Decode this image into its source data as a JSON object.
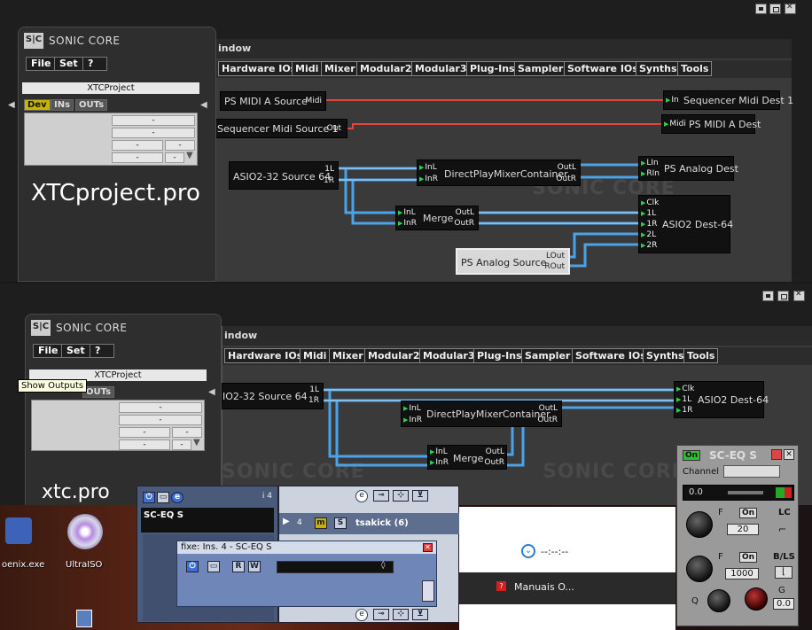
{
  "top": {
    "window_title": "indow",
    "tabs": [
      "Hardware IOs",
      "Midi",
      "Mixer",
      "Modular2",
      "Modular3",
      "Plug-Ins",
      "Sampler",
      "Software IOs",
      "Synths",
      "Tools"
    ],
    "sidebar": {
      "brand": "SONIC CORE",
      "logo": "S|C",
      "menu": [
        "File",
        "Set",
        "?"
      ],
      "project": "XTCProject",
      "subtabs": [
        "Dev",
        "INs",
        "OUTs"
      ],
      "cells": [
        "-",
        "-",
        "-",
        "-",
        "-",
        "-"
      ],
      "big_label": "XTCproject.pro"
    },
    "watermark": "SONIC CORE",
    "nodes": {
      "ps_midi_src": {
        "name": "PS MIDI A Source",
        "pin": "Midi"
      },
      "seq_midi_dest": {
        "pin": "In",
        "name": "Sequencer Midi Dest 1"
      },
      "seq_midi_src": {
        "name": "Sequencer Midi Source 1",
        "pin": "Out"
      },
      "ps_midi_dest": {
        "pin": "Midi",
        "name": "PS MIDI A Dest"
      },
      "asio_src": {
        "name": "ASIO2-32 Source 64",
        "pins": [
          "1L",
          "1R"
        ]
      },
      "dpmc": {
        "name": "DirectPlayMixerContainer",
        "in": [
          "InL",
          "InR"
        ],
        "out": [
          "OutL",
          "OutR"
        ]
      },
      "ps_analog_dest": {
        "name": "PS Analog Dest",
        "pins": [
          "LIn",
          "RIn"
        ]
      },
      "merge": {
        "name": "Merge",
        "in": [
          "InL",
          "InR"
        ],
        "out": [
          "OutL",
          "OutR"
        ]
      },
      "asio_dest": {
        "name": "ASIO2 Dest-64",
        "pins": [
          "Clk",
          "1L",
          "1R",
          "2L",
          "2R"
        ]
      },
      "ps_analog_src": {
        "name": "PS Analog Source",
        "pins": [
          "LOut",
          "ROut"
        ]
      }
    }
  },
  "bottom": {
    "window_title": "indow",
    "tabs": [
      "Hardware IOs",
      "Midi",
      "Mixer",
      "Modular2",
      "Modular3",
      "Plug-Ins",
      "Sampler",
      "Software IOs",
      "Synths",
      "Tools"
    ],
    "sidebar": {
      "brand": "SONIC CORE",
      "logo": "S|C",
      "menu": [
        "File",
        "Set",
        "?"
      ],
      "project": "XTCProject",
      "subtab_visible": "OUTs",
      "tooltip": "Show Outputs",
      "cells": [
        "-",
        "-",
        "-",
        "-",
        "-",
        "-"
      ],
      "big_label": "xtc.pro"
    },
    "nodes": {
      "asio_src": {
        "name": "IO2-32 Source 64",
        "pins": [
          "1L",
          "1R"
        ]
      },
      "dpmc": {
        "name": "DirectPlayMixerContainer",
        "in": [
          "InL",
          "InR"
        ],
        "out": [
          "OutL",
          "OutR"
        ]
      },
      "asio_dest": {
        "name": "ASIO2 Dest-64",
        "pins": [
          "Clk",
          "1L",
          "1R"
        ]
      },
      "merge": {
        "name": "Merge",
        "in": [
          "InL",
          "InR"
        ],
        "out": [
          "OutL",
          "OutR"
        ]
      }
    }
  },
  "desktop": {
    "icons": [
      {
        "label": "oenix.exe",
        "icon": "app-icon"
      },
      {
        "label": "UltraISO",
        "icon": "disc-icon"
      }
    ]
  },
  "cubase": {
    "track_number": "i 4",
    "insert_name": "SC-EQ S",
    "track_index": "4",
    "mute": "m",
    "solo": "S",
    "track_name": "tsakick (6)",
    "ins_window_title": "fixe: Ins. 4 - SC-EQ S",
    "ins_buttons": [
      "R",
      "W"
    ],
    "time": "--:--:--"
  },
  "browser": {
    "item": "Manuais O..."
  },
  "sceq": {
    "title": "SC-EQ S",
    "on": "On",
    "channel_label": "Channel",
    "level": "0.0",
    "band1": {
      "label": "F",
      "on": "On",
      "value": "20",
      "type": "LC"
    },
    "band2": {
      "label": "F",
      "on": "On",
      "value": "1000",
      "type": "B/LS"
    },
    "q_label": "Q",
    "g_label": "G",
    "g_value": "0.0"
  },
  "colors": {
    "midi_cable": "#e0463c",
    "audio_cable": "#4aa3e8",
    "active_tab": "#c8b400"
  }
}
